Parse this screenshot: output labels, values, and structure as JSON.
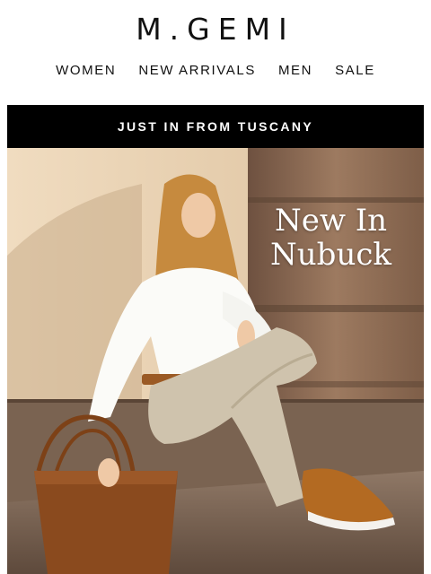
{
  "brand": {
    "logo": "M.GEMI"
  },
  "nav": {
    "items": [
      "WOMEN",
      "NEW ARRIVALS",
      "MEN",
      "SALE"
    ]
  },
  "banner": {
    "text": "JUST IN FROM TUSCANY"
  },
  "hero": {
    "title_line1": "New In",
    "title_line2": "Nubuck",
    "image_subject": "woman seated on stone step with tan suede tote bag and cognac perforated sneakers"
  },
  "colors": {
    "banner_bg": "#000000",
    "wall": "#e6cfae",
    "stone": "#8c6b52",
    "bag": "#8a4a1e",
    "sneaker": "#b36a22"
  }
}
